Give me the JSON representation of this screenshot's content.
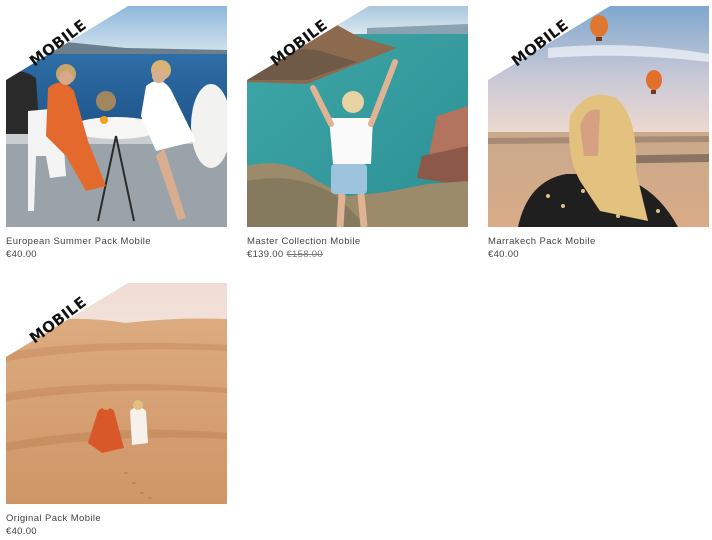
{
  "products": [
    {
      "badge": "MOBILE",
      "title": "European Summer Pack Mobile",
      "price": "€40.00",
      "old_price": ""
    },
    {
      "badge": "MOBILE",
      "title": "Master Collection Mobile",
      "price": "€139.00",
      "old_price": "€158.00"
    },
    {
      "badge": "MOBILE",
      "title": "Marrakech Pack Mobile",
      "price": "€40.00",
      "old_price": ""
    },
    {
      "badge": "MOBILE",
      "title": "Original Pack Mobile",
      "price": "€40.00",
      "old_price": ""
    }
  ]
}
